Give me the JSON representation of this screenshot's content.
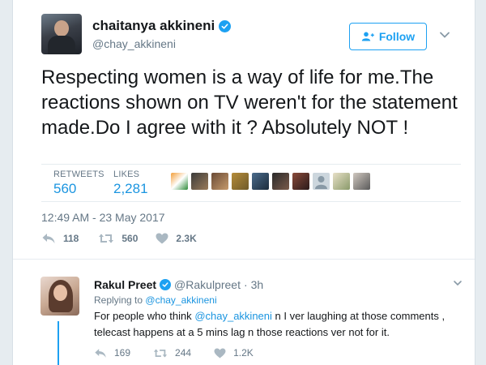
{
  "colors": {
    "accent": "#1da1f2",
    "link": "#1b95e0",
    "muted": "#657786",
    "text": "#14171a"
  },
  "tweet": {
    "author": {
      "display_name": "chaitanya akkineni",
      "handle": "@chay_akkineni",
      "verified": true
    },
    "follow_label": "Follow",
    "text": "Respecting women is a way of life for me.The reactions shown on TV weren't for the statement made.Do I agree with it ? Absolutely NOT !",
    "stats": {
      "retweets_label": "RETWEETS",
      "retweets_value": "560",
      "likes_label": "LIKES",
      "likes_value": "2,281"
    },
    "timestamp": "12:49 AM - 23 May 2017",
    "actions": {
      "replies": "118",
      "retweets": "560",
      "likes": "2.3K"
    },
    "liker_avatars": 10
  },
  "reply": {
    "author": {
      "display_name": "Rakul Preet",
      "handle": "@Rakulpreet",
      "verified": true
    },
    "time": "3h",
    "replying_to_prefix": "Replying to",
    "replying_to_handle": "@chay_akkineni",
    "text_before_mention": "For people who think",
    "mention": "@chay_akkineni",
    "text_after_mention": "n I ver laughing at those comments , telecast happens at a 5 mins lag n those reactions ver not for it.",
    "actions": {
      "replies": "169",
      "retweets": "244",
      "likes": "1.2K"
    }
  }
}
